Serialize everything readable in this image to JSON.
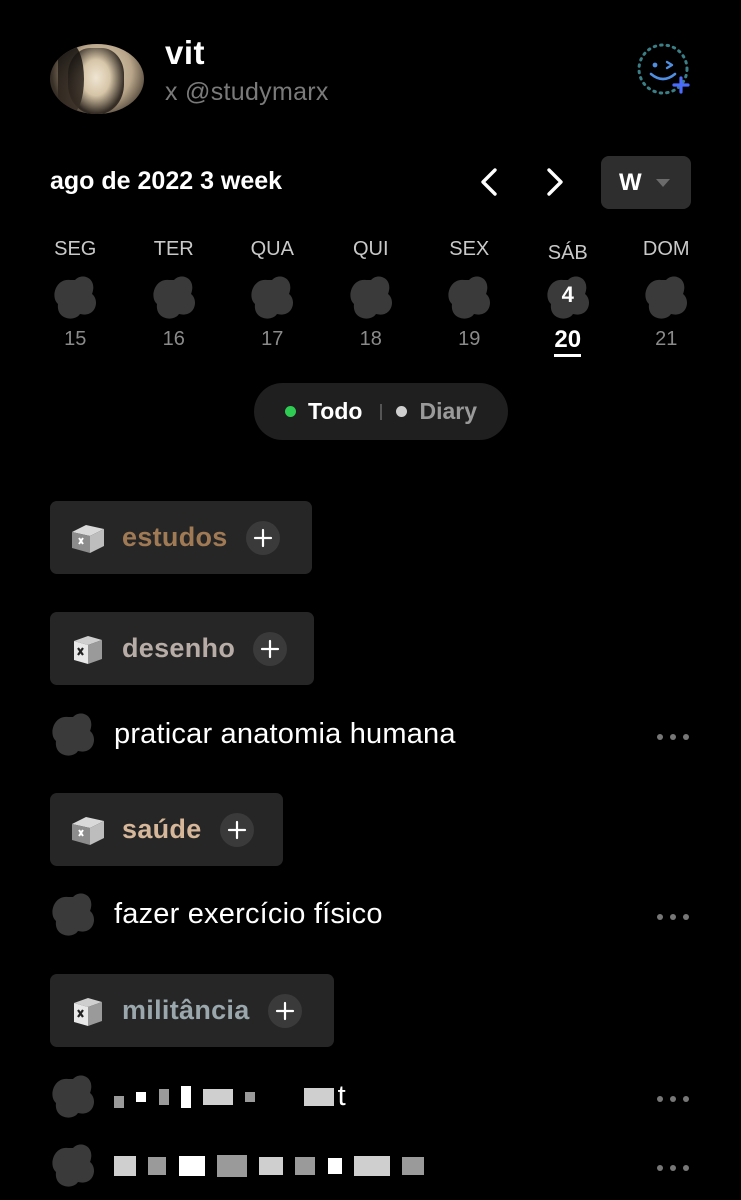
{
  "profile": {
    "name": "vit",
    "handle": "x @studymarx"
  },
  "calendar": {
    "title": "ago de 2022 3 week",
    "view_mode": "W",
    "days": [
      {
        "dow": "SEG",
        "date": "15",
        "count": ""
      },
      {
        "dow": "TER",
        "date": "16",
        "count": ""
      },
      {
        "dow": "QUA",
        "date": "17",
        "count": ""
      },
      {
        "dow": "QUI",
        "date": "18",
        "count": ""
      },
      {
        "dow": "SEX",
        "date": "19",
        "count": ""
      },
      {
        "dow": "SÁB",
        "date": "20",
        "count": "4",
        "today": true
      },
      {
        "dow": "DOM",
        "date": "21",
        "count": ""
      }
    ]
  },
  "toggle": {
    "todo_label": "Todo",
    "diary_label": "Diary",
    "todo_dot_color": "#2ecc52",
    "diary_dot_color": "#cfcfcf"
  },
  "categories": [
    {
      "label": "estudos",
      "color": "#a07a55"
    },
    {
      "label": "desenho",
      "color": "#b7aca6"
    },
    {
      "label": "saúde",
      "color": "#d7b79a"
    },
    {
      "label": "militância",
      "color": "#9aa7ad"
    }
  ],
  "tasks": [
    {
      "label": "praticar anatomia humana"
    },
    {
      "label": "fazer exercício físico"
    },
    {
      "label": "t"
    },
    {
      "label": ""
    }
  ],
  "colors": {
    "background": "#000000",
    "chip_bg": "#262626",
    "clover": "#3a3a3a",
    "accent_blue": "#4b6bff"
  },
  "icons": {
    "add_friend": "smile-add-icon",
    "prev": "chevron-left-icon",
    "next": "chevron-right-icon",
    "category": "box-icon",
    "more": "more-horizontal-icon"
  }
}
